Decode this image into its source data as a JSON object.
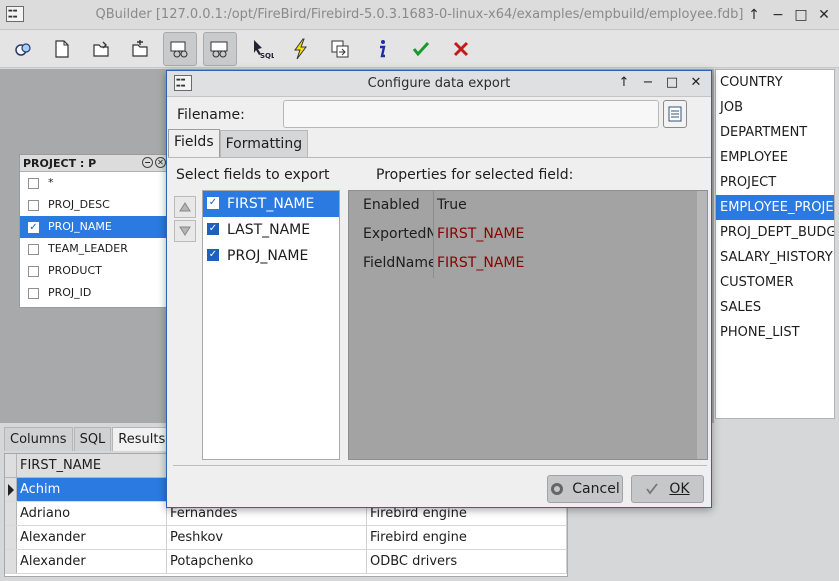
{
  "window": {
    "title": "QBuilder [127.0.0.1:/opt/FireBird/Firebird-5.0.3.1683-0-linux-x64/examples/empbuild/employee.fdb]",
    "controls": {
      "pin": "↑",
      "minimize": "−",
      "maximize": "□",
      "close": "✕"
    }
  },
  "toolbar": {
    "buttons": [
      "connect-icon",
      "new-icon",
      "open-icon",
      "save-icon",
      "visual-builder-icon",
      "design-icon",
      "sql-icon",
      "execute-icon",
      "export-icon",
      "info-icon",
      "commit-icon",
      "rollback-icon"
    ]
  },
  "project_box": {
    "header": "PROJECT : P",
    "fields": [
      {
        "label": "*",
        "checked": false
      },
      {
        "label": "PROJ_DESC",
        "checked": false
      },
      {
        "label": "PROJ_NAME",
        "checked": true,
        "selected": true
      },
      {
        "label": "TEAM_LEADER",
        "checked": false
      },
      {
        "label": "PRODUCT",
        "checked": false
      },
      {
        "label": "PROJ_ID",
        "checked": false
      }
    ]
  },
  "tables": [
    "COUNTRY",
    "JOB",
    "DEPARTMENT",
    "EMPLOYEE",
    "PROJECT",
    "EMPLOYEE_PROJECT",
    "PROJ_DEPT_BUDGET",
    "SALARY_HISTORY",
    "CUSTOMER",
    "SALES",
    "PHONE_LIST"
  ],
  "tables_selected": "EMPLOYEE_PROJECT",
  "bottom_tabs": [
    "Columns",
    "SQL",
    "Results"
  ],
  "bottom_active_tab": "Results",
  "results": {
    "header": "FIRST_NAME",
    "rows": [
      [
        "Achim",
        "",
        ""
      ],
      [
        "Adriano",
        "Fernandes",
        "Firebird engine"
      ],
      [
        "Alexander",
        "Peshkov",
        "Firebird engine"
      ],
      [
        "Alexander",
        "Potapchenko",
        "ODBC drivers"
      ]
    ]
  },
  "dialog": {
    "title": "Configure data export",
    "controls": {
      "pin": "↑",
      "minimize": "−",
      "maximize": "□",
      "close": "✕"
    },
    "filename_label": "Filename:",
    "filename_value": "",
    "tabs": [
      "Fields",
      "Formatting"
    ],
    "active_tab": "Fields",
    "select_fields_label": "Select fields to export",
    "properties_label": "Properties for selected field:",
    "fields": [
      {
        "name": "FIRST_NAME",
        "checked": true,
        "selected": true
      },
      {
        "name": "LAST_NAME",
        "checked": true,
        "selected": false
      },
      {
        "name": "PROJ_NAME",
        "checked": true,
        "selected": false
      }
    ],
    "properties": [
      {
        "key": "Enabled",
        "value": "True",
        "red": false
      },
      {
        "key": "ExportedName",
        "value": "FIRST_NAME",
        "red": true
      },
      {
        "key": "FieldName",
        "value": "FIRST_NAME",
        "red": true
      }
    ],
    "cancel_label": "Cancel",
    "ok_label": "OK"
  }
}
